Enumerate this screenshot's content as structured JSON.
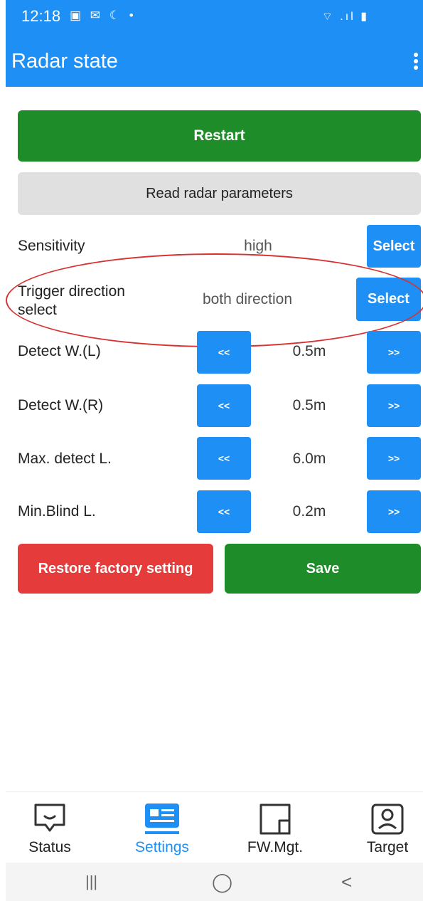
{
  "status_bar": {
    "time": "12:18",
    "left_icons": "▣ ✉ ☾ •",
    "right_icons": "⌔ .ıl ▮"
  },
  "app_bar": {
    "title": "Radar state"
  },
  "actions": {
    "restart_label": "Restart",
    "read_params_label": "Read radar parameters",
    "restore_label": "Restore factory setting",
    "save_label": "Save"
  },
  "settings": {
    "sensitivity": {
      "label": "Sensitivity",
      "value": "high",
      "button": "Select"
    },
    "trigger_direction": {
      "label": "Trigger direction select",
      "value": "both direction",
      "button": "Select"
    },
    "detect_w_left": {
      "label": "Detect W.(L)",
      "value": "0.5m",
      "dec": "<<",
      "inc": ">>"
    },
    "detect_w_right": {
      "label": "Detect W.(R)",
      "value": "0.5m",
      "dec": "<<",
      "inc": ">>"
    },
    "max_detect_length": {
      "label": "Max. detect L.",
      "value": "6.0m",
      "dec": "<<",
      "inc": ">>"
    },
    "min_blind_length": {
      "label": "Min.Blind L.",
      "value": "0.2m",
      "dec": "<<",
      "inc": ">>"
    }
  },
  "bottom_nav": {
    "items": [
      {
        "label": "Status",
        "icon": "chat-bubble-icon",
        "active": false
      },
      {
        "label": "Settings",
        "icon": "settings-card-icon",
        "active": true
      },
      {
        "label": "FW.Mgt.",
        "icon": "firmware-icon",
        "active": false
      },
      {
        "label": "Target",
        "icon": "person-badge-icon",
        "active": false
      }
    ]
  },
  "system_nav": {
    "recents": "|||",
    "home": "◯",
    "back": "<"
  },
  "colors": {
    "primary_blue": "#1e90f5",
    "green": "#1f8c2a",
    "red": "#e53b3b",
    "grey_button": "#e0e0e0",
    "annotation_red": "#d93030"
  }
}
